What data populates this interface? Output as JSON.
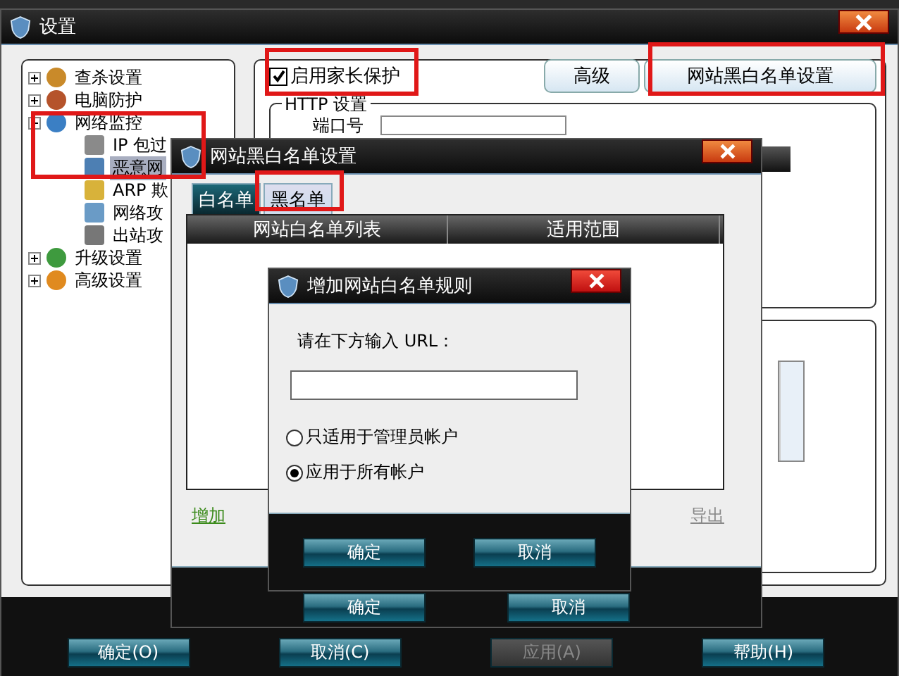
{
  "main_window": {
    "title": "设置",
    "tree": [
      {
        "label": "查杀设置",
        "expanded": false
      },
      {
        "label": "电脑防护",
        "expanded": false
      },
      {
        "label": "网络监控",
        "expanded": true,
        "children": [
          {
            "label": "IP 包过",
            "selected": false
          },
          {
            "label": "恶意网",
            "selected": true
          },
          {
            "label": "ARP 欺",
            "selected": false
          },
          {
            "label": "网络攻",
            "selected": false
          },
          {
            "label": "出站攻",
            "selected": false
          }
        ]
      },
      {
        "label": "升级设置",
        "expanded": false
      },
      {
        "label": "高级设置",
        "expanded": false
      }
    ],
    "parental_checkbox": {
      "label": "启用家长保护",
      "checked": true
    },
    "top_buttons": [
      "高级",
      "网站黑白名单设置"
    ],
    "http_group": {
      "title": "HTTP 设置",
      "port_label": "端口号"
    },
    "buttons": [
      {
        "label": "确定(O)",
        "disabled": false
      },
      {
        "label": "取消(C)",
        "disabled": false
      },
      {
        "label": "应用(A)",
        "disabled": true
      },
      {
        "label": "帮助(H)",
        "disabled": false
      }
    ]
  },
  "list_dialog": {
    "title": "网站黑白名单设置",
    "tabs": [
      {
        "label": "白名单",
        "selected": true
      },
      {
        "label": "黑名单",
        "selected": false
      }
    ],
    "columns": [
      "网站白名单列表",
      "适用范围"
    ],
    "links": [
      {
        "label": "增加",
        "disabled": false
      },
      {
        "label": "导出",
        "disabled": true
      }
    ],
    "buttons": [
      "确定",
      "取消"
    ]
  },
  "rule_dialog": {
    "title": "增加网站白名单规则",
    "prompt": "请在下方输入 URL：",
    "options": [
      {
        "label": "只适用于管理员帐户",
        "selected": false
      },
      {
        "label": "应用于所有帐户",
        "selected": true
      }
    ],
    "buttons": [
      "确定",
      "取消"
    ]
  }
}
